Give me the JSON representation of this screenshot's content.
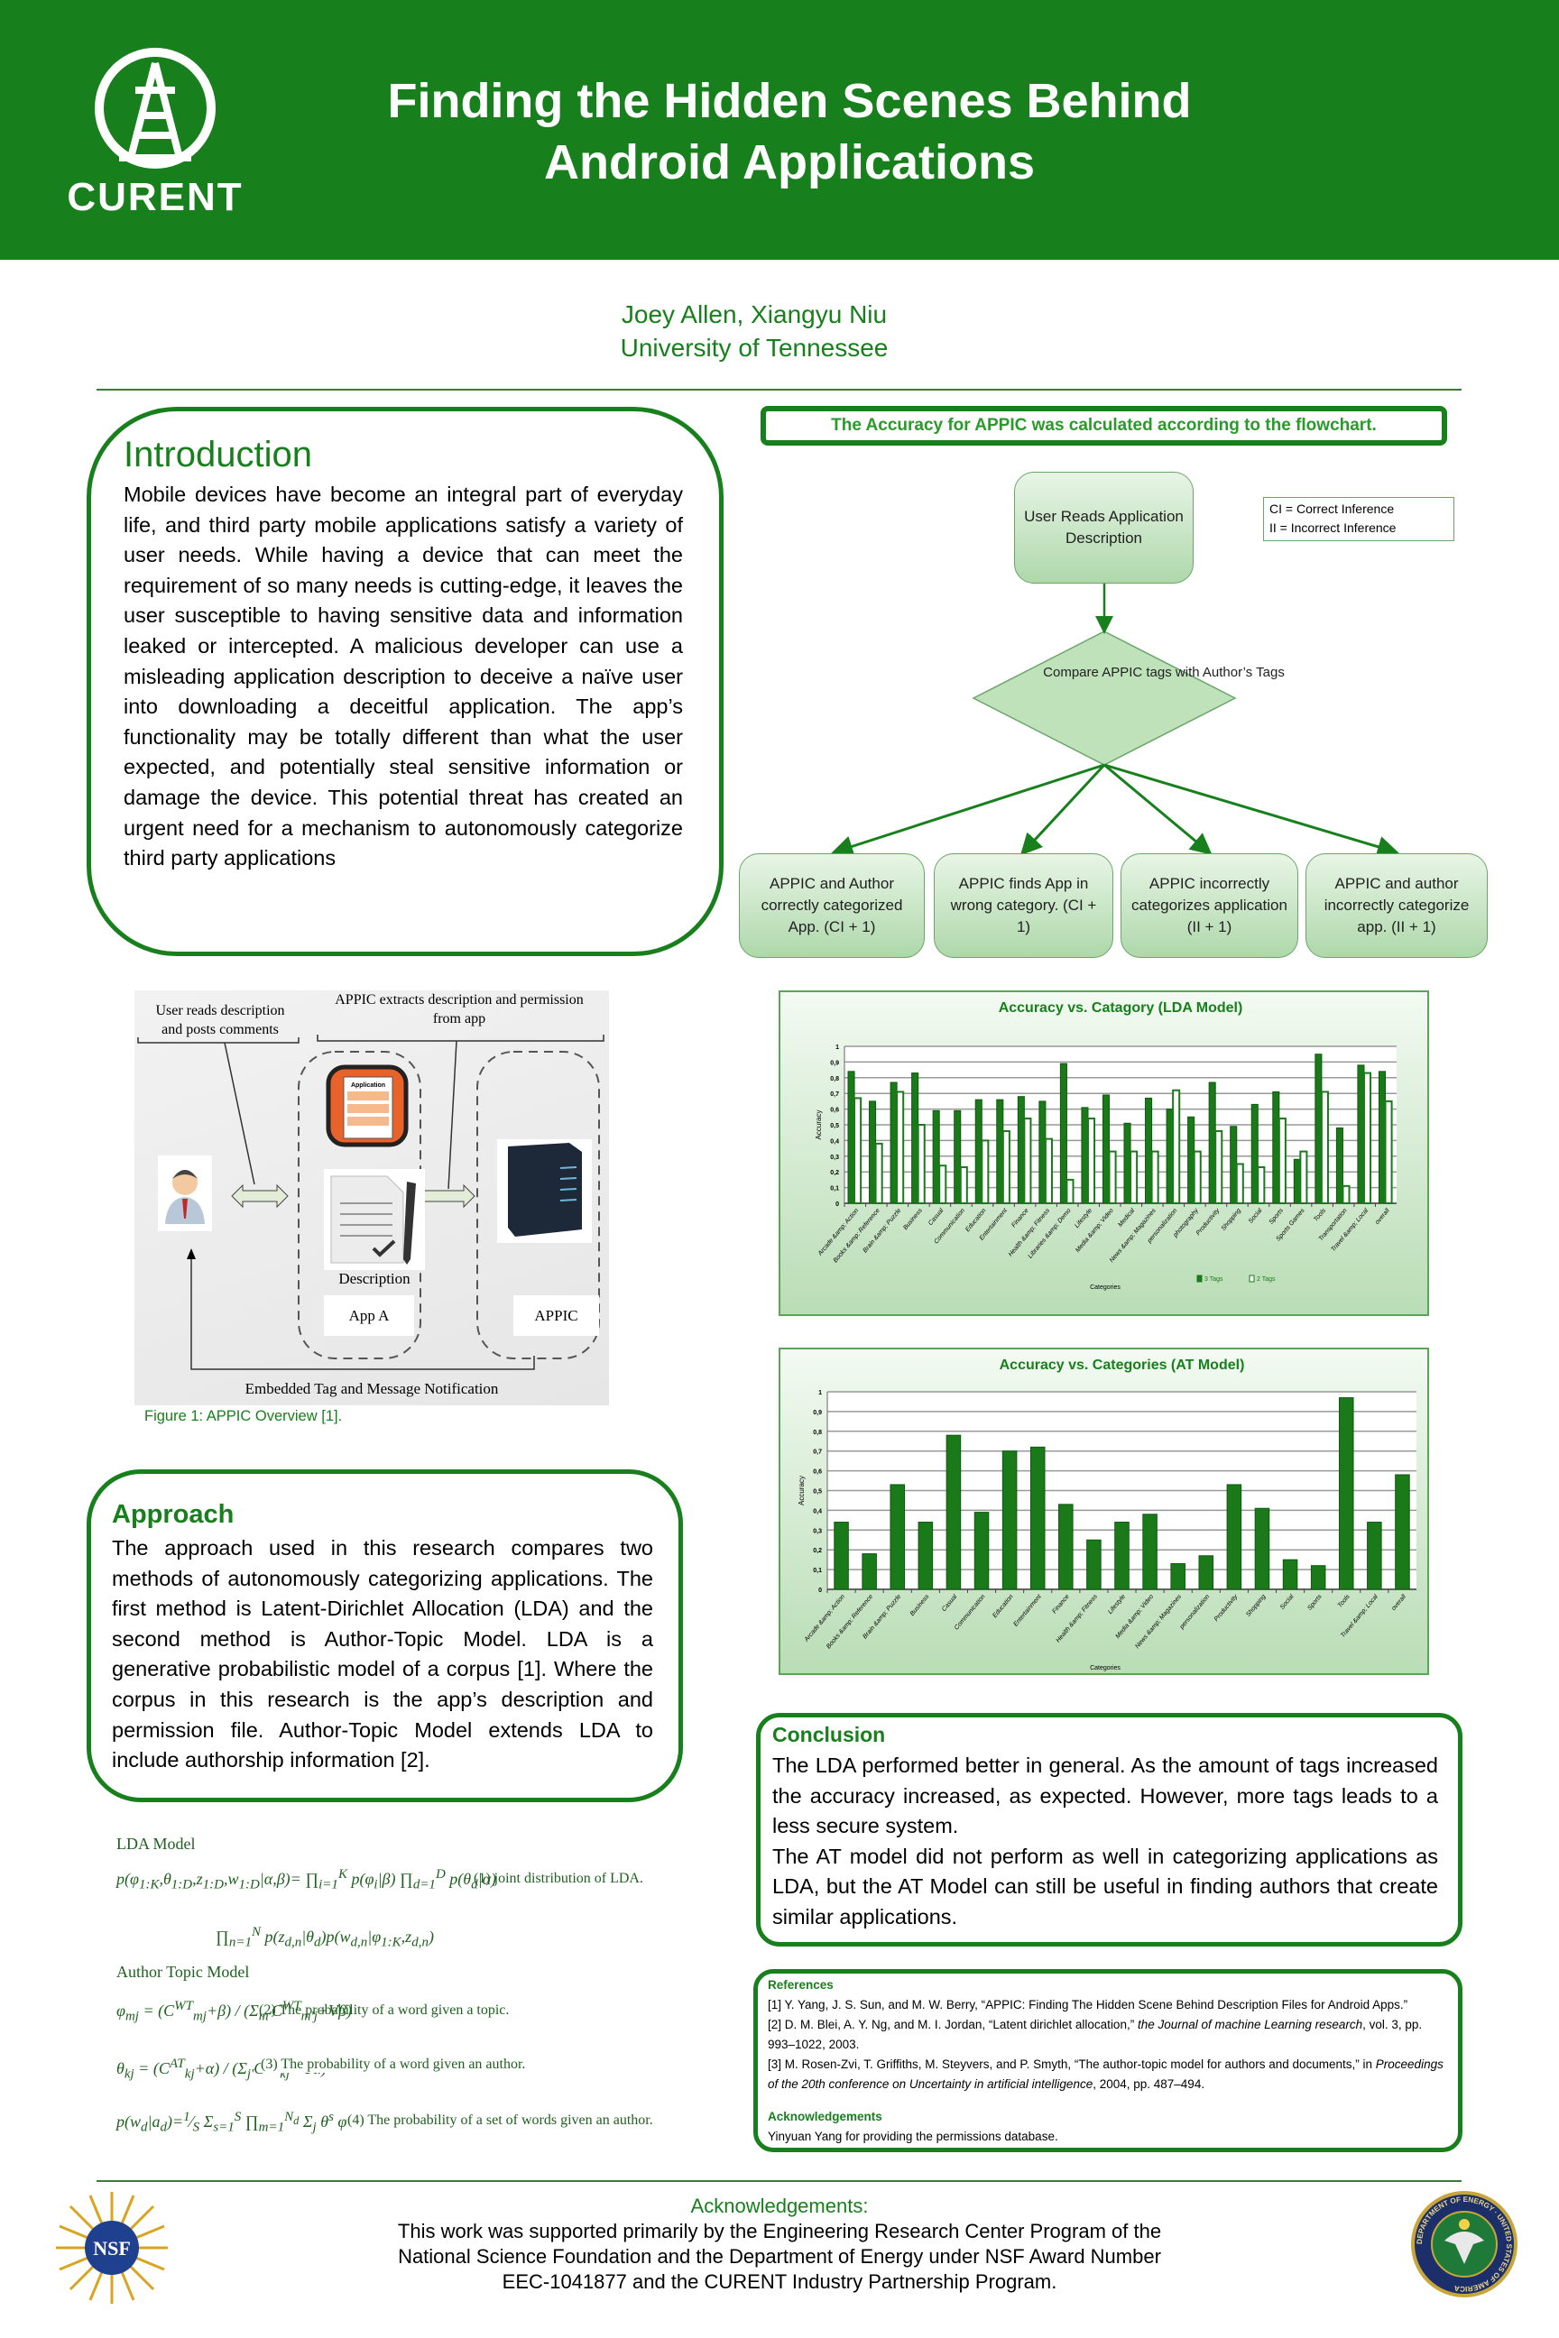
{
  "header": {
    "logo_text": "CURENT",
    "title_line1": "Finding the Hidden Scenes Behind",
    "title_line2": "Android Applications",
    "authors": "Joey Allen, Xiangyu Niu",
    "affiliation": "University of Tennessee"
  },
  "colors": {
    "brand_green": "#17801c",
    "bar_green": "#1a7a1a"
  },
  "introduction": {
    "title": "Introduction",
    "body": "Mobile devices have become an integral part of everyday life, and third party mobile applications satisfy a variety of user needs. While having a device that can meet the requirement of so many needs is cutting-edge, it leaves the user susceptible to having sensitive data and information leaked or intercepted. A malicious developer can use a misleading application description to deceive a naïve user into downloading a deceitful application.  The app’s functionality may be totally different than what the user expected, and potentially steal sensitive information or damage the device.  This potential threat has created an urgent need for a mechanism to autonomously categorize third party applications"
  },
  "figure1": {
    "label_user": "User reads description and posts comments",
    "label_appic_extract": "APPIC extracts description and permission from app",
    "icon_app_label": "Application",
    "label_description": "Description",
    "label_app_a": "App A",
    "label_appic": "APPIC",
    "label_feedback": "Embedded Tag and Message Notification",
    "caption": "Figure 1: APPIC Overview [1]."
  },
  "approach": {
    "title": "Approach",
    "body": "The approach used in this research compares two methods of autonomously categorizing applications. The first method is Latent-Dirichlet Allocation (LDA) and the second method is Author-Topic Model. LDA is a generative probabilistic model of a corpus [1]. Where the corpus in this research is the app’s description and permission file.  Author-Topic Model extends LDA to include authorship information [2]."
  },
  "equations": {
    "lda_heading": "LDA Model",
    "eq1_desc": "(1) joint distribution of LDA.",
    "at_heading": "Author Topic Model",
    "eq2_desc": "(2) The probability of a word given a topic.",
    "eq3_desc": "(3) The probability of a word given an author.",
    "eq4_desc": "(4) The probability of a set of words given an author."
  },
  "flowchart": {
    "banner": "The Accuracy for APPIC was calculated according to the flowchart.",
    "start": "User Reads Application Description",
    "decision": "Compare APPIC tags with Author’s Tags",
    "legend": [
      "CI = Correct Inference",
      "II = Incorrect Inference"
    ],
    "outcomes": [
      "APPIC and Author correctly categorized App. (CI + 1)",
      "APPIC  finds App in wrong category. (CI + 1)",
      "APPIC incorrectly categorizes application (II + 1)",
      "APPIC and author incorrectly categorize app. (II + 1)"
    ]
  },
  "chart_data": [
    {
      "type": "bar",
      "title": "Accuracy vs. Catagory (LDA Model)",
      "xlabel": "Categories",
      "ylabel": "Accuracy",
      "ylim": [
        0,
        1
      ],
      "yticks": [
        "0",
        "0,1",
        "0,2",
        "0,3",
        "0,4",
        "0,5",
        "0,6",
        "0,7",
        "0,8",
        "0,9",
        "1"
      ],
      "grid": true,
      "legend_position": "bottom-right",
      "categories": [
        "Arcade &amp; Action",
        "Books &amp; Reference",
        "Brain &amp; Puzzle",
        "Business",
        "Casual",
        "Communication",
        "Education",
        "Entertainment",
        "Finance",
        "Health &amp; Fitness",
        "Libraries &amp; Demo",
        "Lifestyle",
        "Media &amp; Video",
        "Medical",
        "News &amp; Magazines",
        "personalization",
        "photography",
        "Productivity",
        "Shopping",
        "Social",
        "Sports",
        "Sports Games",
        "Tools",
        "Transportation",
        "Travel &amp; Local",
        "overall"
      ],
      "series": [
        {
          "name": "3 Tags",
          "values": [
            0.84,
            0.65,
            0.77,
            0.83,
            0.59,
            0.59,
            0.66,
            0.66,
            0.68,
            0.65,
            0.89,
            0.61,
            0.69,
            0.51,
            0.67,
            0.6,
            0.55,
            0.77,
            0.49,
            0.63,
            0.71,
            0.28,
            0.95,
            0.48,
            0.88,
            0.84
          ]
        },
        {
          "name": "2 Tags",
          "values": [
            0.67,
            0.38,
            0.71,
            0.5,
            0.24,
            0.23,
            0.4,
            0.46,
            0.54,
            0.41,
            0.15,
            0.54,
            0.33,
            0.33,
            0.33,
            0.72,
            0.33,
            0.46,
            0.25,
            0.23,
            0.54,
            0.33,
            0.71,
            0.11,
            0.83,
            0.65
          ]
        }
      ]
    },
    {
      "type": "bar",
      "title": "Accuracy vs. Categories (AT Model)",
      "xlabel": "Categories",
      "ylabel": "Accuracy",
      "ylim": [
        0,
        1
      ],
      "yticks": [
        "0",
        "0,1",
        "0,2",
        "0,3",
        "0,4",
        "0,5",
        "0,6",
        "0,7",
        "0,8",
        "0,9",
        "1"
      ],
      "grid": true,
      "categories": [
        "Arcade &amp; Action",
        "Books &amp; Reference",
        "Brain &amp; Puzzle",
        "Business",
        "Casual",
        "Communication",
        "Education",
        "Entertainment",
        "Finance",
        "Health &amp; Fitness",
        "Lifestyle",
        "Media &amp; Video",
        "News &amp; Magazines",
        "personalization",
        "Productivity",
        "Shopping",
        "Social",
        "Sports",
        "Tools",
        "Travel &amp; Local",
        "overall"
      ],
      "values": [
        0.34,
        0.18,
        0.53,
        0.34,
        0.78,
        0.39,
        0.7,
        0.72,
        0.43,
        0.25,
        0.34,
        0.38,
        0.13,
        0.17,
        0.53,
        0.41,
        0.15,
        0.12,
        0.97,
        0.34,
        0.58
      ]
    }
  ],
  "conclusion": {
    "title": "Conclusion",
    "p1": "The LDA performed better in general.  As the amount of tags increased the accuracy increased, as expected. However, more tags leads to a less secure system.",
    "p2": "The AT model did not perform as well in categorizing applications as LDA, but the AT Model can still be useful in finding  authors that create similar applications."
  },
  "references": {
    "title": "References",
    "r1": "[1] Y. Yang, J. S. Sun, and M. W. Berry, “APPIC: Finding The Hidden Scene Behind Description Files for Android Apps.”",
    "r2a": "[2] D. M. Blei, A. Y. Ng, and M. I. Jordan, “Latent dirichlet allocation,” ",
    "r2_journal": "the Journal of machine Learning research",
    "r2b": ", vol. 3, pp. 993–1022, 2003.",
    "r3a": "[3] M. Rosen-Zvi, T. Griffiths, M. Steyvers, and P. Smyth, “The author-topic model for authors and documents,” in ",
    "r3_proc": "Proceedings of the 20th conference on Uncertainty in artificial intelligence",
    "r3b": ", 2004, pp. 487–494.",
    "ack_title": "Acknowledgements",
    "ack_text": "Yinyuan Yang for providing the permissions database."
  },
  "footer": {
    "title": "Acknowledgements:",
    "line1": "This work was supported primarily by the Engineering Research Center Program of the",
    "line2": "National Science Foundation and the Department of Energy under NSF Award Number",
    "line3": "EEC-1041877 and the CURENT Industry Partnership Program.",
    "nsf_logo_text": "NSF",
    "doe_logo_text": "DEPARTMENT OF ENERGY · UNITED STATES OF AMERICA"
  }
}
